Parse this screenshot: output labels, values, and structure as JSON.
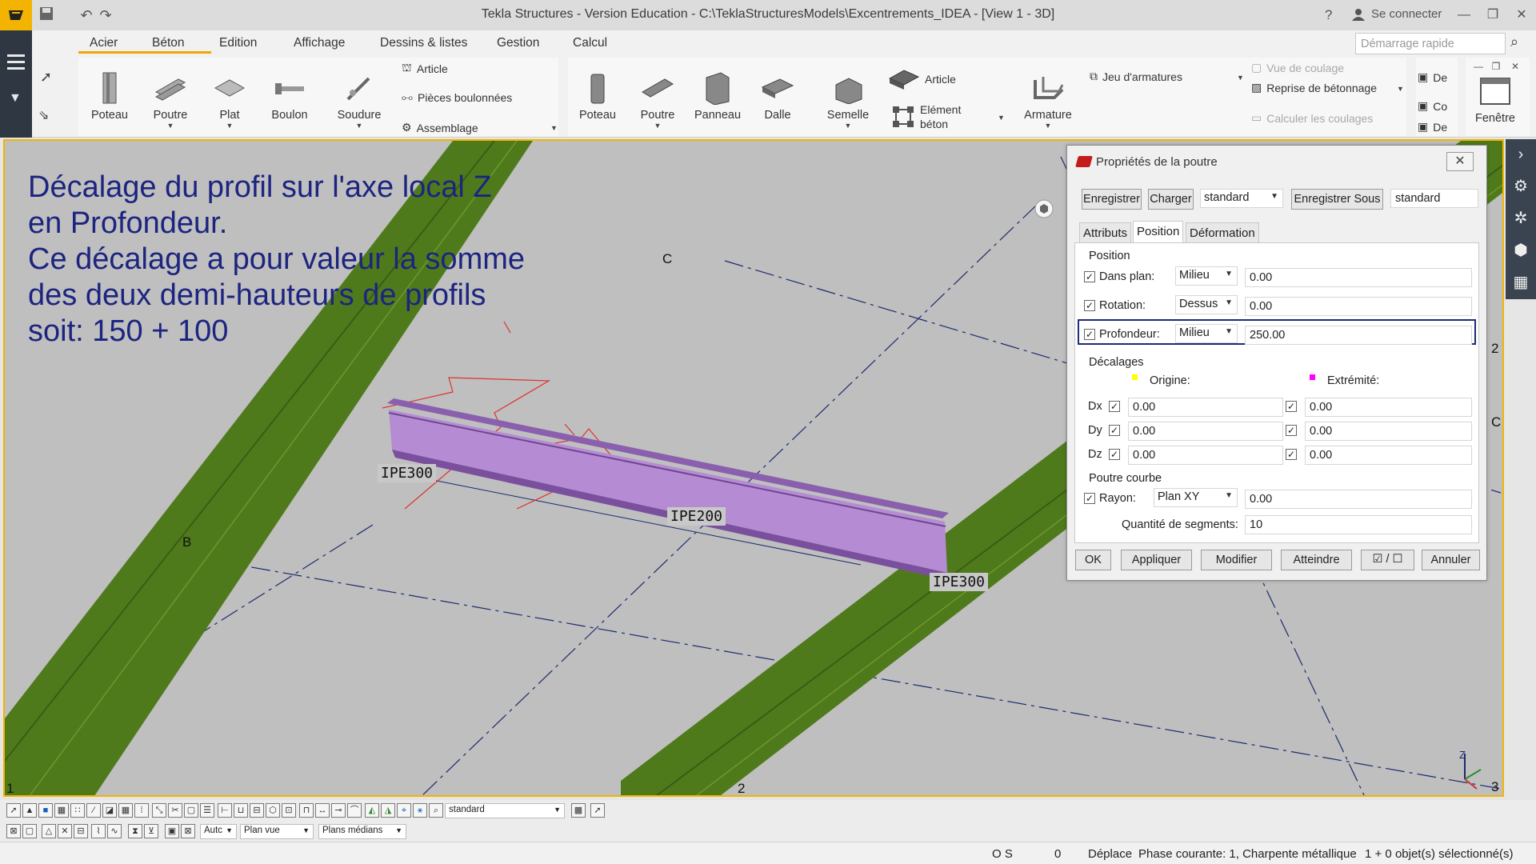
{
  "app": {
    "title": "Tekla Structures - Version Education - C:\\TeklaStructuresModels\\Excentrements_IDEA  - [View 1 - 3D]",
    "help": "?",
    "connect": "Se connecter"
  },
  "ribbon": {
    "tabs": [
      "Acier",
      "Béton",
      "Edition",
      "Affichage",
      "Dessins & listes",
      "Gestion",
      "Calcul"
    ],
    "quick_search_placeholder": "Démarrage rapide",
    "acier": {
      "poteau": "Poteau",
      "poutre": "Poutre",
      "plat": "Plat",
      "boulon": "Boulon",
      "soudure": "Soudure",
      "article": "Article",
      "pieces_boulonnees": "Pièces boulonnées",
      "assemblage": "Assemblage"
    },
    "beton": {
      "poteau": "Poteau",
      "poutre": "Poutre",
      "panneau": "Panneau",
      "dalle": "Dalle",
      "semelle": "Semelle",
      "article": "Article",
      "element_beton_1": "Elément",
      "element_beton_2": "béton",
      "armature": "Armature",
      "jeu_armatures": "Jeu d'armatures",
      "vue_coulage": "Vue de coulage",
      "reprise_betonnage": "Reprise de bétonnage",
      "calculer_coulages": "Calculer les coulages"
    },
    "partial": {
      "d1": "De",
      "d2": "Co",
      "d3": "De"
    },
    "fenetre": "Fenêtre"
  },
  "viewport": {
    "overlay_lines": [
      "Décalage du profil sur l'axe local Z",
      "en Profondeur.",
      "Ce décalage a pour valeur la somme",
      "des deux demi-hauteurs de profils",
      "soit: 150 + 100"
    ],
    "labels": {
      "ipe300_left": "IPE300",
      "ipe200": "IPE200",
      "ipe300_right": "IPE300"
    },
    "grid": {
      "c_top": "C",
      "b_left": "B",
      "two_right": "2",
      "c_right": "C",
      "one_bottom": "1",
      "two_bottom": "2",
      "three_corner": "3",
      "z_axis": "Z"
    }
  },
  "dialog": {
    "title": "Propriétés de la poutre",
    "close": "✕",
    "save": "Enregistrer",
    "load": "Charger",
    "preset_select": "standard",
    "save_as": "Enregistrer Sous",
    "save_as_name": "standard",
    "tabs": [
      "Attributs",
      "Position",
      "Déformation"
    ],
    "position_header": "Position",
    "dans_plan": {
      "label": "Dans plan:",
      "select": "Milieu",
      "value": "0.00"
    },
    "rotation": {
      "label": "Rotation:",
      "select": "Dessus",
      "value": "0.00"
    },
    "profondeur": {
      "label": "Profondeur:",
      "select": "Milieu",
      "value": "250.00"
    },
    "decalages_header": "Décalages",
    "origine": "Origine:",
    "extremite": "Extrémité:",
    "dx": {
      "label": "Dx",
      "origin": "0.00",
      "end": "0.00"
    },
    "dy": {
      "label": "Dy",
      "origin": "0.00",
      "end": "0.00"
    },
    "dz": {
      "label": "Dz",
      "origin": "0.00",
      "end": "0.00"
    },
    "poutre_courbe": "Poutre courbe",
    "rayon": {
      "label": "Rayon:",
      "select": "Plan XY",
      "value": "0.00"
    },
    "segments": {
      "label": "Quantité de segments:",
      "value": "10"
    },
    "buttons": {
      "ok": "OK",
      "apply": "Appliquer",
      "modify": "Modifier",
      "reach": "Atteindre",
      "toggle": "☑ / ☐",
      "cancel": "Annuler"
    },
    "colors": {
      "origin_dot": "#ffff00",
      "end_dot": "#ff00ff",
      "highlight": "#1f2a7a"
    }
  },
  "bottom": {
    "view_select": "standard",
    "auto_select": "Autc",
    "plane_select": "Plan vue",
    "median_select": "Plans médians"
  },
  "status": {
    "os": "O S",
    "zero": "0",
    "deplace": "Déplace",
    "phase": "Phase courante: 1, Charpente métallique",
    "selection": "1 + 0 objet(s) sélectionné(s)"
  },
  "colors": {
    "accent": "#f2b400",
    "beam_green": "#4f7a1c",
    "beam_purple": "#a97fc9",
    "overlay_text": "#1c2480"
  }
}
